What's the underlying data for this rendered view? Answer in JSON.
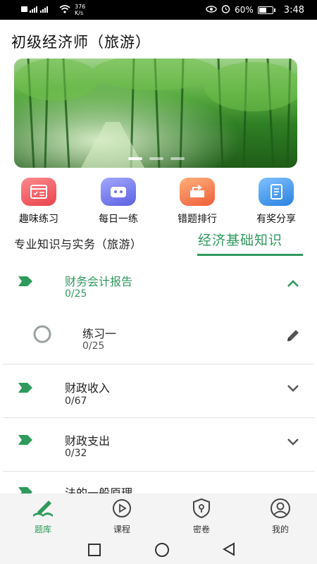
{
  "status_bar": {
    "network_speed": "376",
    "network_speed_unit": "K/s",
    "battery": "60%",
    "battery_level": 0.6,
    "time": "3:48"
  },
  "app": {
    "title": "初级经济师（旅游）"
  },
  "quick_actions": [
    {
      "label": "趣味练习",
      "icon": "quiz-list-icon",
      "color": "#ee4c52"
    },
    {
      "label": "每日一练",
      "icon": "daily-robot-icon",
      "color": "#6d73e8"
    },
    {
      "label": "错题排行",
      "icon": "mistake-rank-icon",
      "color": "#f2703c"
    },
    {
      "label": "有奖分享",
      "icon": "share-book-icon",
      "color": "#2f8ce6"
    }
  ],
  "subject_tabs": {
    "left": "专业知识与实务（旅游）",
    "right": "经济基础知识"
  },
  "chapters": [
    {
      "name": "财务会计报告",
      "count": "0/25",
      "expanded": true,
      "exercises": [
        {
          "name": "练习一",
          "count": "0/25"
        }
      ]
    },
    {
      "name": "财政收入",
      "count": "0/67",
      "expanded": false
    },
    {
      "name": "财政支出",
      "count": "0/32",
      "expanded": false
    },
    {
      "name": "法的一般原理",
      "count": "",
      "expanded": false
    }
  ],
  "bottom_nav": [
    {
      "label": "题库",
      "icon": "question-bank-icon",
      "active": true
    },
    {
      "label": "课程",
      "icon": "play-course-icon",
      "active": false
    },
    {
      "label": "密卷",
      "icon": "secret-paper-icon",
      "active": false
    },
    {
      "label": "我的",
      "icon": "profile-icon",
      "active": false
    }
  ],
  "colors": {
    "accent": "#2e9a5b"
  }
}
